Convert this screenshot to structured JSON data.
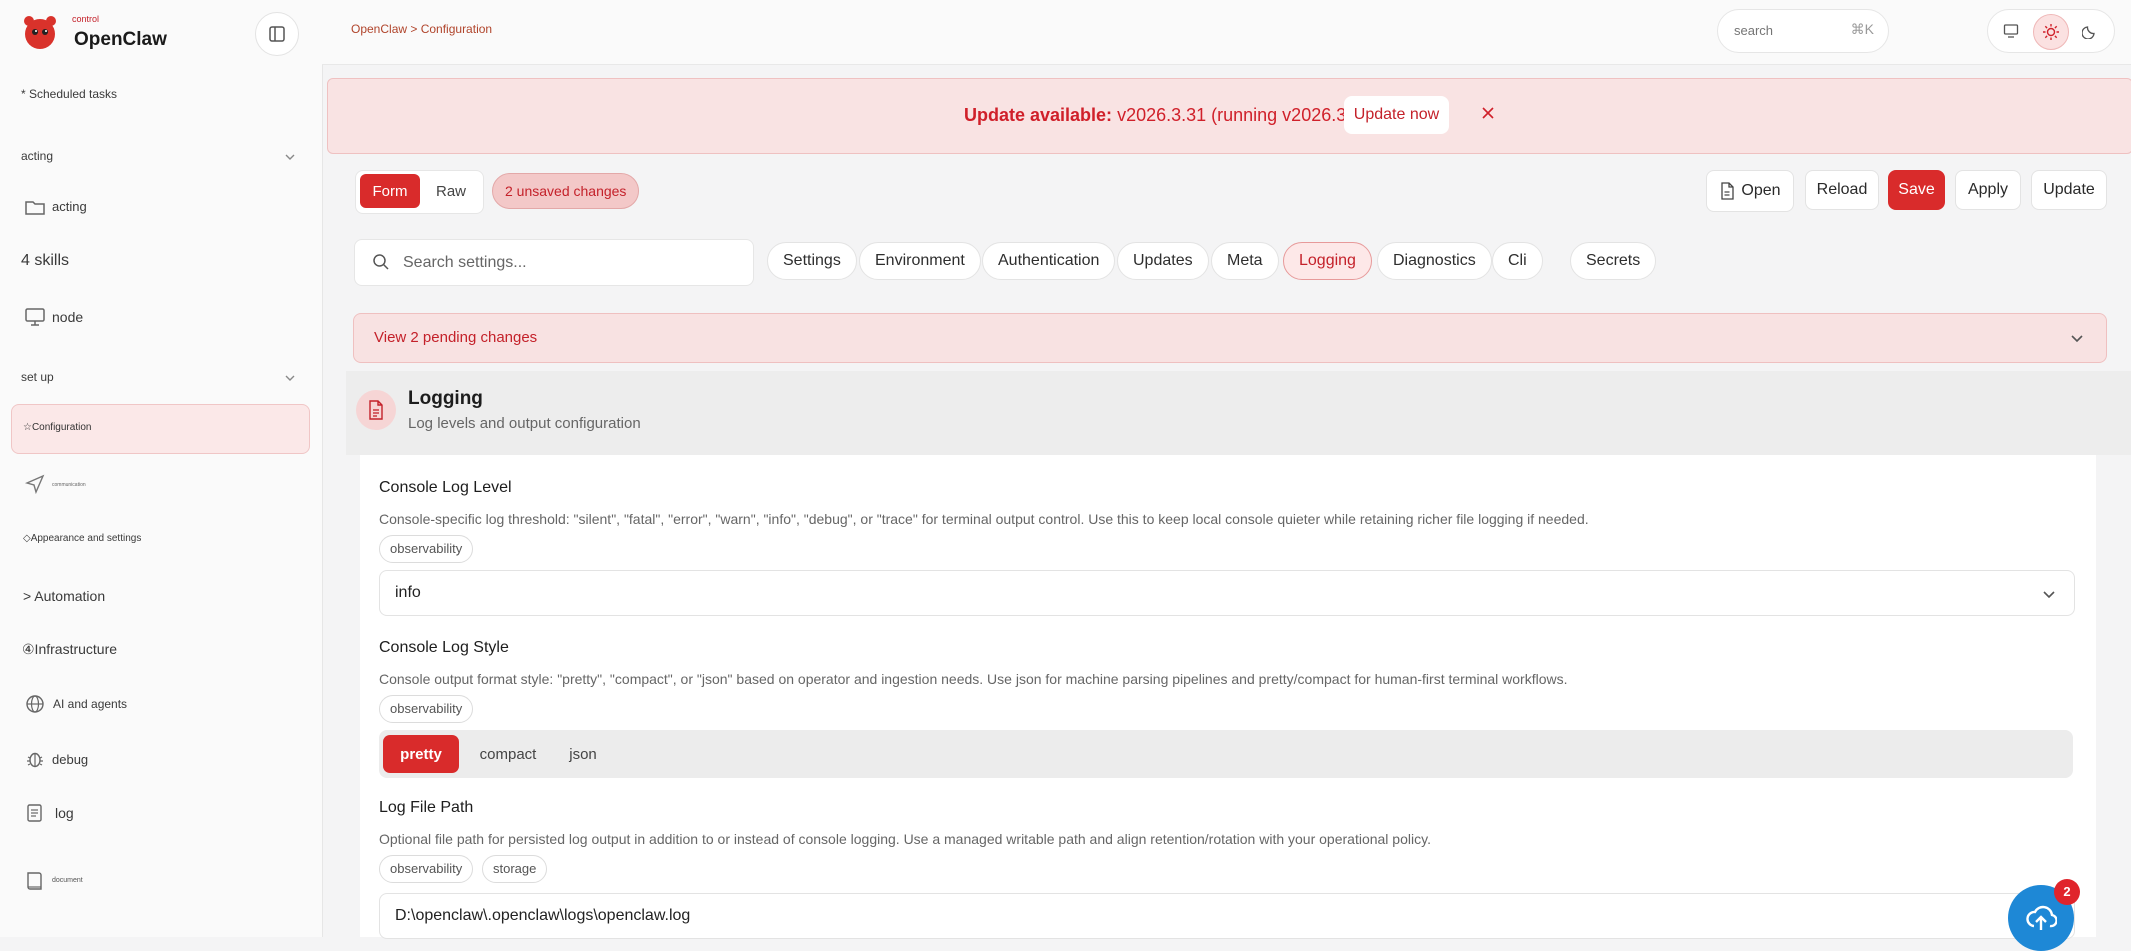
{
  "sidebar": {
    "brand_small": "control",
    "brand_name": "OpenClaw",
    "items": [
      {
        "label": "* Scheduled tasks"
      },
      {
        "label": "acting"
      },
      {
        "label": "acting"
      },
      {
        "label": "4 skills"
      },
      {
        "label": "node"
      },
      {
        "label": "set up"
      },
      {
        "label": "☆Configuration"
      },
      {
        "label": "communication"
      },
      {
        "label": "◇Appearance and settings"
      },
      {
        "label": "> Automation"
      },
      {
        "label": "④Infrastructure"
      },
      {
        "label": "AI and agents"
      },
      {
        "label": "debug"
      },
      {
        "label": "log"
      },
      {
        "label": "document"
      }
    ]
  },
  "topbar": {
    "breadcrumb": "OpenClaw > Configuration",
    "search_placeholder": "search",
    "shortcut": "⌘K"
  },
  "banner": {
    "label": "Update available:",
    "detail": " v2026.3.31 (running v2026.3.28).",
    "button": "Update now"
  },
  "toolbar": {
    "mode_form": "Form",
    "mode_raw": "Raw",
    "unsaved": "2 unsaved changes",
    "open": "Open",
    "reload": "Reload",
    "save": "Save",
    "apply": "Apply",
    "update": "Update"
  },
  "filters": {
    "search_placeholder": "Search settings...",
    "tabs": [
      "Settings",
      "Environment",
      "Authentication",
      "Updates",
      "Meta",
      "Logging",
      "Diagnostics",
      "Cli",
      "Secrets"
    ]
  },
  "pending": "View 2 pending changes",
  "section": {
    "title": "Logging",
    "description": "Log levels and output configuration"
  },
  "fields": {
    "console_level": {
      "title": "Console Log Level",
      "description": "Console-specific log threshold: \"silent\", \"fatal\", \"error\", \"warn\", \"info\", \"debug\", or \"trace\" for terminal output control. Use this to keep local console quieter while retaining richer file logging if needed.",
      "tag": "observability",
      "value": "info"
    },
    "console_style": {
      "title": "Console Log Style",
      "description": "Console output format style: \"pretty\", \"compact\", or \"json\" based on operator and ingestion needs. Use json for machine parsing pipelines and pretty/compact for human-first terminal workflows.",
      "tag": "observability",
      "options": [
        "pretty",
        "compact",
        "json"
      ],
      "selected": "pretty"
    },
    "file_path": {
      "title": "Log File Path",
      "description": "Optional file path for persisted log output in addition to or instead of console logging. Use a managed writable path and align retention/rotation with your operational policy.",
      "tags": [
        "observability",
        "storage"
      ],
      "value": "D:\\openclaw\\.openclaw\\logs\\openclaw.log"
    }
  },
  "fab_badge": "2",
  "colors": {
    "accent": "#d92b2b",
    "accent_soft": "#f9e3e3",
    "fab": "#1e88d6"
  }
}
